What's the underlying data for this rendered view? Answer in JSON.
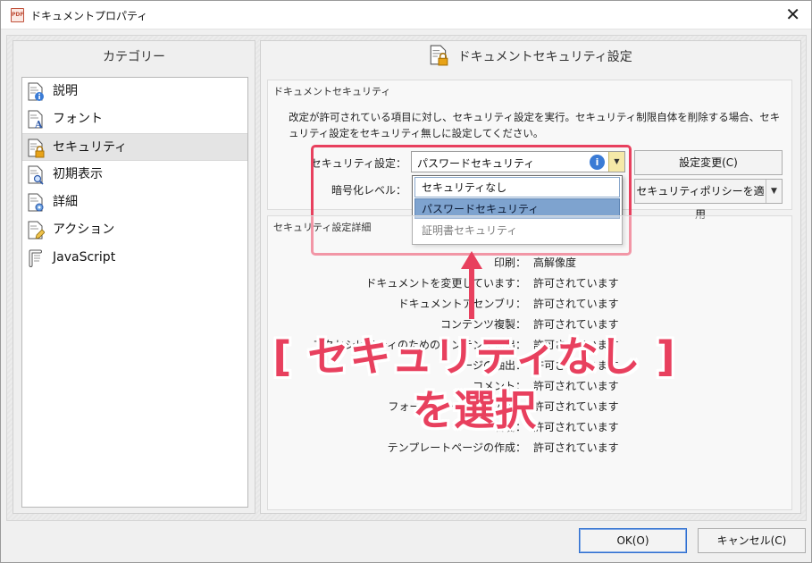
{
  "window": {
    "title": "ドキュメントプロパティ",
    "app_icon_text": "PDF",
    "close_glyph": "✕"
  },
  "sidebar": {
    "header": "カテゴリー",
    "items": [
      {
        "label": "説明",
        "icon": "document-info-icon"
      },
      {
        "label": "フォント",
        "icon": "document-font-icon"
      },
      {
        "label": "セキュリティ",
        "icon": "document-lock-icon",
        "selected": true
      },
      {
        "label": "初期表示",
        "icon": "document-view-icon"
      },
      {
        "label": "詳細",
        "icon": "document-gear-icon"
      },
      {
        "label": "アクション",
        "icon": "document-pencil-icon"
      },
      {
        "label": "JavaScript",
        "icon": "script-icon"
      }
    ]
  },
  "main": {
    "header": "ドキュメントセキュリティ設定",
    "security_group": {
      "title": "ドキュメントセキュリティ",
      "description": "改定が許可されている項目に対し、セキュリティ設定を実行。セキュリティ制限自体を削除する場合、セキュリティ設定をセキュリティ無しに設定してください。",
      "security_label": "セキュリティ設定：",
      "security_value": "パスワードセキュリティ",
      "encryption_label": "暗号化レベル：",
      "dropdown_options": [
        "セキュリティなし",
        "パスワードセキュリティ",
        "証明書セキュリティ"
      ],
      "change_button": "設定変更(C)",
      "apply_policy_button": "セキュリティポリシーを適用"
    },
    "details_group": {
      "title": "セキュリティ設定詳細",
      "rows": [
        {
          "label": "印刷：",
          "value": "高解像度"
        },
        {
          "label": "ドキュメントを変更しています：",
          "value": "許可されています"
        },
        {
          "label": "ドキュメントアセンブリ：",
          "value": "許可されています"
        },
        {
          "label": "コンテンツ複製：",
          "value": "許可されています"
        },
        {
          "label": "アクセシビリティのためのコンテンツ抽出：",
          "value": "許可されています"
        },
        {
          "label": "ページの抽出：",
          "value": "許可されています"
        },
        {
          "label": "コメント：",
          "value": "許可されています"
        },
        {
          "label": "フォームフィールドの入力：",
          "value": "許可されています"
        },
        {
          "label": "署名：",
          "value": "許可されています"
        },
        {
          "label": "テンプレートページの作成：",
          "value": "許可されています"
        }
      ]
    }
  },
  "footer": {
    "ok_button": "OK(O)",
    "cancel_button": "キャンセル(C)"
  },
  "annotation": {
    "line1": "[ セキュリティなし ]",
    "line2": "を選択",
    "color": "#e8405e"
  }
}
